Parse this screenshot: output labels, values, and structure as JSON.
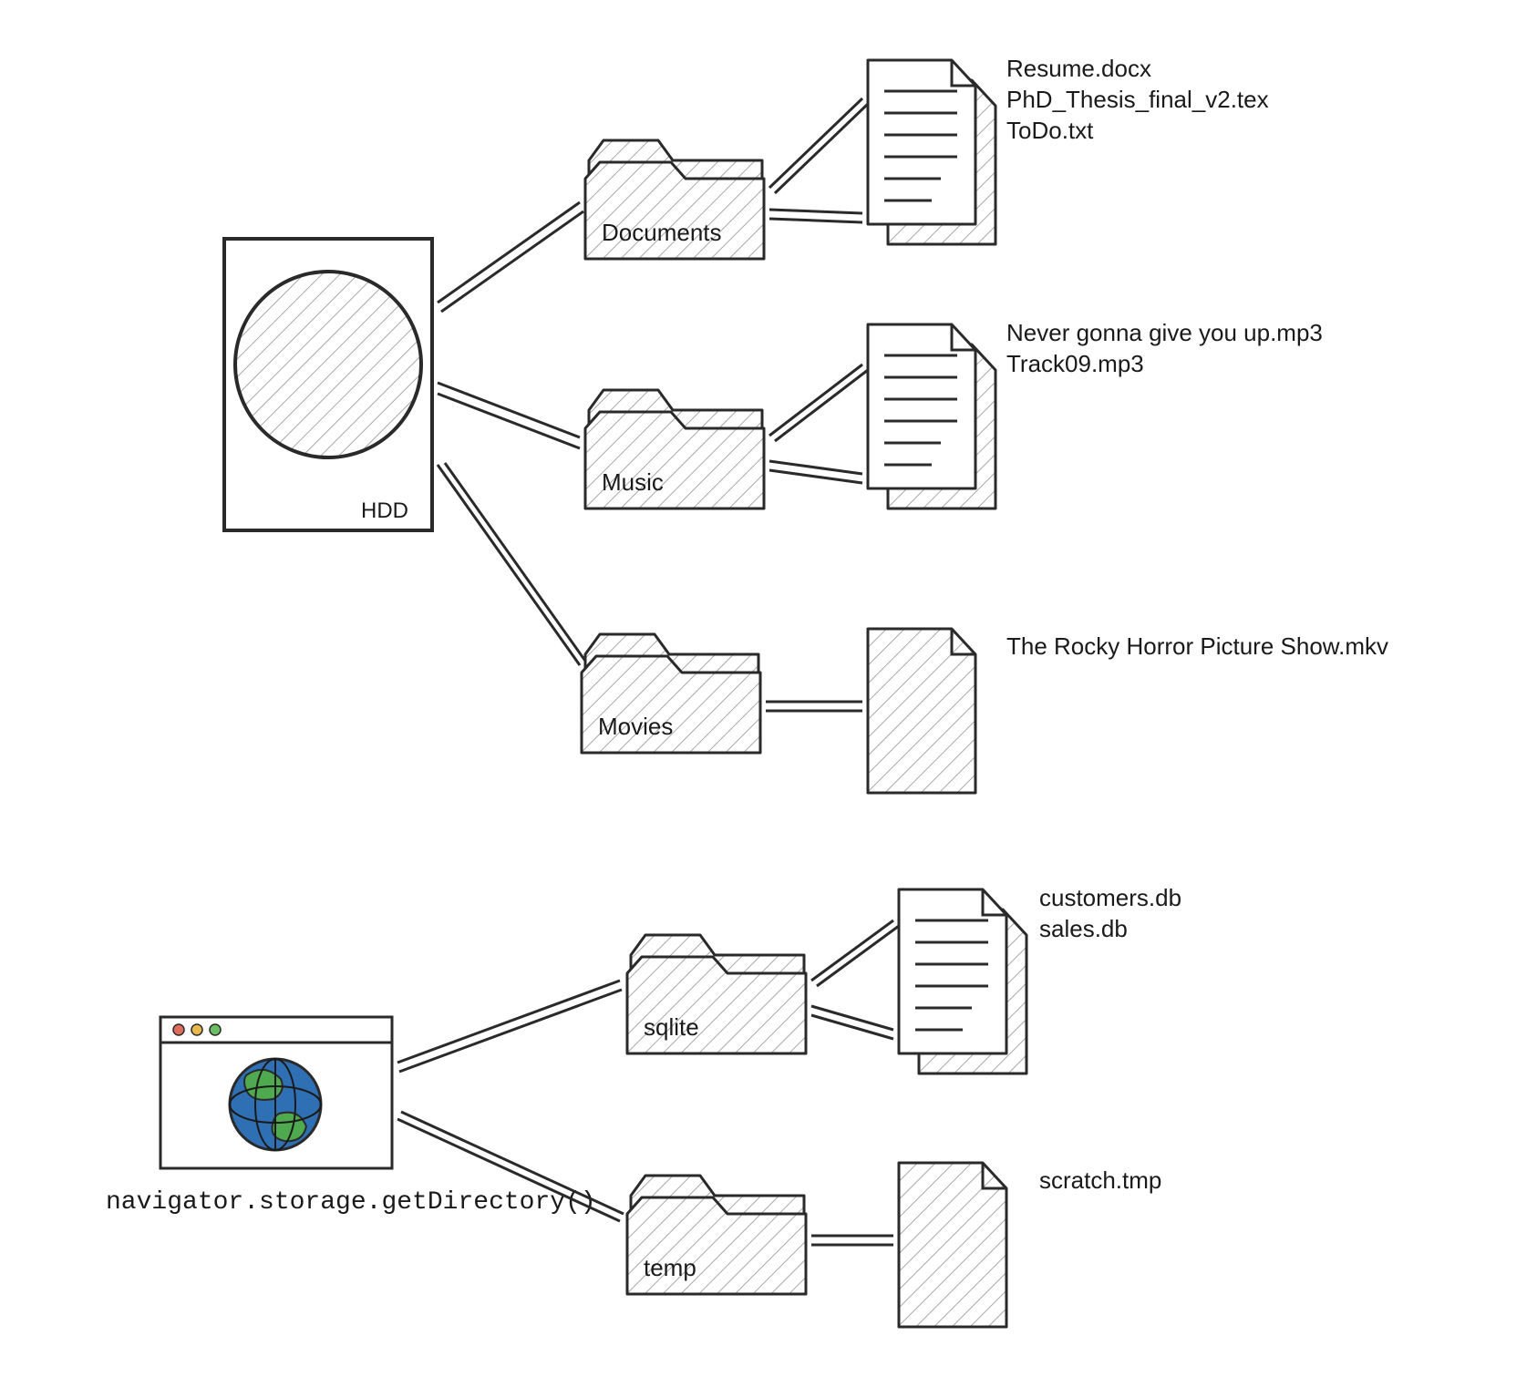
{
  "hdd": {
    "label": "HDD",
    "folders": [
      {
        "name": "Documents",
        "files": [
          "Resume.docx",
          "PhD_Thesis_final_v2.tex",
          "ToDo.txt"
        ]
      },
      {
        "name": "Music",
        "files": [
          "Never gonna give you up.mp3",
          "Track09.mp3"
        ]
      },
      {
        "name": "Movies",
        "files": [
          "The Rocky Horror Picture Show.mkv"
        ]
      }
    ]
  },
  "browser": {
    "api_label": "navigator.storage.getDirectory()",
    "folders": [
      {
        "name": "sqlite",
        "files": [
          "customers.db",
          "sales.db"
        ]
      },
      {
        "name": "temp",
        "files": [
          "scratch.tmp"
        ]
      }
    ]
  }
}
